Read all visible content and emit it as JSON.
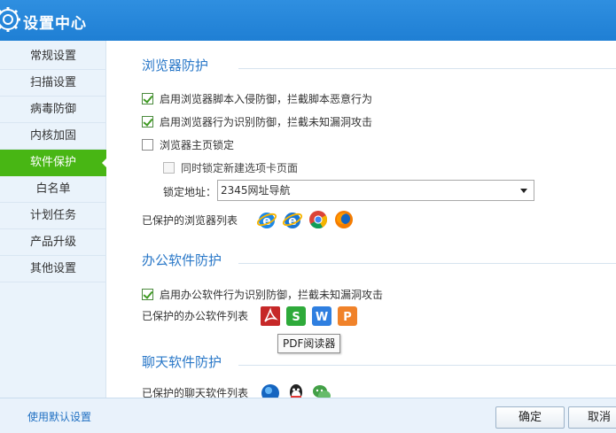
{
  "window": {
    "title": "设置中心"
  },
  "sidebar": {
    "items": [
      {
        "label": "常规设置"
      },
      {
        "label": "扫描设置"
      },
      {
        "label": "病毒防御"
      },
      {
        "label": "内核加固"
      },
      {
        "label": "软件保护",
        "active": true
      },
      {
        "label": "白名单"
      },
      {
        "label": "计划任务"
      },
      {
        "label": "产品升级"
      },
      {
        "label": "其他设置"
      }
    ]
  },
  "browser": {
    "title": "浏览器防护",
    "options": [
      {
        "label": "启用浏览器脚本入侵防御，拦截脚本恶意行为",
        "checked": true
      },
      {
        "label": "启用浏览器行为识别防御，拦截未知漏洞攻击",
        "checked": true
      },
      {
        "label": "浏览器主页锁定",
        "checked": false
      },
      {
        "label": "同时锁定新建选项卡页面",
        "checked": false
      }
    ],
    "lock_label": "锁定地址：",
    "lock_value": "2345网址导航",
    "protected_label": "已保护的浏览器列表",
    "icons": [
      "ie-icon",
      "edge-icon",
      "chrome-icon",
      "firefox-icon"
    ]
  },
  "office": {
    "title": "办公软件防护",
    "option": {
      "label": "启用办公软件行为识别防御，拦截未知漏洞攻击",
      "checked": true
    },
    "protected_label": "已保护的办公软件列表",
    "icons": [
      "pdf-icon",
      "wps-spreadsheet-icon",
      "wps-writer-icon",
      "wps-presentation-icon"
    ],
    "tooltip": "PDF阅读器"
  },
  "chat": {
    "title": "聊天软件防护",
    "protected_label": "已保护的聊天软件列表",
    "icons": [
      "chat-globe-icon",
      "qq-icon",
      "wechat-icon"
    ]
  },
  "footer": {
    "default_link": "使用默认设置",
    "ok": "确定",
    "cancel": "取消"
  },
  "colors": {
    "titlebar": "#2386da",
    "accent": "#48b614",
    "section": "#2a78c8"
  }
}
